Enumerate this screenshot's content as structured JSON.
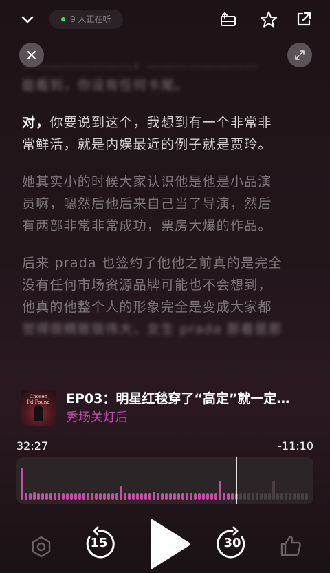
{
  "header": {
    "listeners": "9 人正在听",
    "icons": [
      "chevron-down-icon",
      "tray-icon",
      "star-icon",
      "share-icon"
    ]
  },
  "overlay_icons": [
    "close-icon",
    "expand-icon"
  ],
  "transcript": {
    "blurred_top": [
      "……………………，……………………",
      "能看到，你没有任何卡尾。"
    ],
    "current": {
      "lead": "对，",
      "lines": [
        "你要说到这个，我想到有一个非常非",
        "常鲜活，就是内娱最近的例子就是贾玲。"
      ]
    },
    "para2": [
      "她其实小的时候大家认识他是他是小品演",
      "员嘛，嗯然后他后来自己当了导演，然后",
      "有两部非常非常成功，票房大爆的作品。"
    ],
    "para3": [
      "后来 prada 也签约了他他之前真的是完全",
      "没有任何市场资源品牌可能也不会想到，",
      "他真的他整个人的形象完全是变成大家都"
    ],
    "blurred_bottom": "觉得很精致很伟大，女生 prada 那着是那"
  },
  "episode": {
    "title": "EP03：明星红毯穿了“高定”就一定…",
    "show": "秀场关灯后",
    "cover_text": "Chosen\nI'd Found"
  },
  "player": {
    "elapsed": "32:27",
    "remaining": "-11:10",
    "progress": 0.745,
    "skip_back": "15",
    "skip_forward": "30",
    "accent_color": "#c24fa3"
  },
  "waveform": [
    0.82,
    0.18,
    0.18,
    0.2,
    0.18,
    0.18,
    0.18,
    0.18,
    0.18,
    0.18,
    0.18,
    0.18,
    0.18,
    0.18,
    0.18,
    0.18,
    0.18,
    0.18,
    0.18,
    0.18,
    0.18,
    0.18,
    0.18,
    0.18,
    0.36,
    0.18,
    0.18,
    0.18,
    0.18,
    0.18,
    0.18,
    0.18,
    0.2,
    0.18,
    0.18,
    0.18,
    0.18,
    0.18,
    0.18,
    0.18,
    0.18,
    0.18,
    0.18,
    0.18,
    0.18,
    0.18,
    0.18,
    0.18,
    0.48,
    0.18,
    0.18,
    0.18,
    0.18,
    0.18,
    0.18,
    0.18,
    0.18,
    0.18,
    0.18,
    0.18,
    0.18,
    0.5,
    0.18,
    0.18,
    0.18,
    0.18,
    0.18,
    0.18,
    0.18,
    0.18,
    0.18,
    0.18,
    0.18,
    0.18,
    0.18,
    0.18,
    0.18,
    0.18,
    0.18,
    0.18,
    0.18,
    0.18,
    0.18,
    0.18,
    0.18,
    0.18,
    0.18,
    0.18,
    0.18,
    0.18,
    0.18,
    0.18,
    0.18,
    0.18,
    0.18,
    0.18,
    0.18,
    0.18,
    0.18,
    0.18,
    0.18,
    0.18,
    0.18,
    0.18
  ]
}
